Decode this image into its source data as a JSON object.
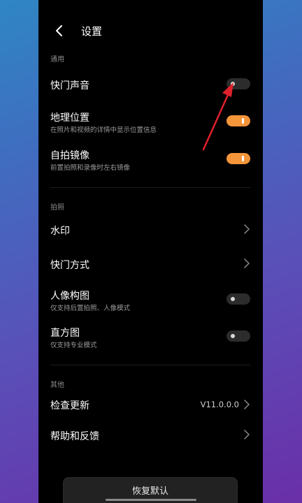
{
  "header": {
    "title": "设置"
  },
  "sections": {
    "general": "通用",
    "photo": "拍照",
    "other": "其他"
  },
  "settings": {
    "shutter_sound": {
      "title": "快门声音",
      "enabled": false
    },
    "location": {
      "title": "地理位置",
      "subtitle": "在照片和视频的详情中显示位置信息",
      "enabled": true
    },
    "selfie_mirror": {
      "title": "自拍镜像",
      "subtitle": "前置拍照和录像时左右镜像",
      "enabled": true
    },
    "watermark": {
      "title": "水印"
    },
    "shutter_mode": {
      "title": "快门方式"
    },
    "portrait_composition": {
      "title": "人像构图",
      "subtitle": "仅支持后置拍照、人像模式",
      "enabled": false
    },
    "histogram": {
      "title": "直方图",
      "subtitle": "仅支持专业模式",
      "enabled": false
    },
    "check_update": {
      "title": "检查更新",
      "value": "V11.0.0.0"
    },
    "help_feedback": {
      "title": "帮助和反馈"
    }
  },
  "reset_button": "恢复默认",
  "colors": {
    "accent": "#f5953a",
    "annotation_arrow": "#e0212b"
  },
  "icons": [
    "back-arrow-icon",
    "chevron-right-icon"
  ]
}
